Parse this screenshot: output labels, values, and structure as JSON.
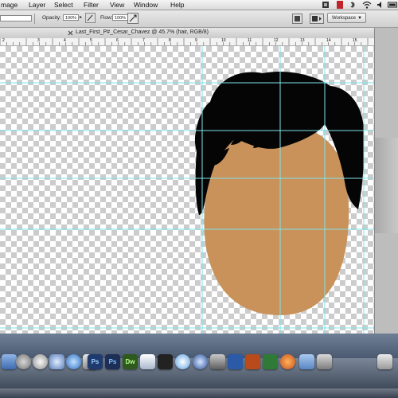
{
  "menubar": {
    "items": [
      "mage",
      "Layer",
      "Select",
      "Filter",
      "View",
      "Window",
      "Help"
    ]
  },
  "options_bar": {
    "opacity_label": "Opacity:",
    "opacity_value": "100%",
    "flow_label": "Flow:",
    "flow_value": "100%",
    "workspace_label": "Workspace"
  },
  "document": {
    "tab_title": "Last_First_P#_Cesar_Chavez @ 45.7% (hair, RGB/8)"
  },
  "ruler_marks": [
    "2",
    "3",
    "4",
    "5",
    "6",
    "7",
    "8",
    "9",
    "10",
    "11",
    "12",
    "13",
    "14",
    "15"
  ],
  "colors": {
    "skin": "#c9925a",
    "hair": "#050505",
    "guides": "#7fe3ea",
    "checker": "#cccccc"
  },
  "dock": {
    "apps": [
      {
        "label": "",
        "icon": "finder-icon"
      },
      {
        "label": "",
        "icon": "compass-icon"
      },
      {
        "label": "",
        "icon": "clock-icon"
      },
      {
        "label": "",
        "icon": "ichat-icon"
      },
      {
        "label": "",
        "icon": "safari-icon"
      },
      {
        "label": "",
        "icon": "mail-icon"
      },
      {
        "label": "Ps",
        "icon": "photoshop-icon"
      },
      {
        "label": "Ps",
        "icon": "photoshop-cs-icon"
      },
      {
        "label": "Dw",
        "icon": "dreamweaver-icon"
      },
      {
        "label": "",
        "icon": "preview-icon"
      },
      {
        "label": "",
        "icon": "terminal-icon"
      },
      {
        "label": "",
        "icon": "itunes-icon"
      },
      {
        "label": "",
        "icon": "quicktime-icon"
      },
      {
        "label": "",
        "icon": "chess-icon"
      },
      {
        "label": "",
        "icon": "word-icon"
      },
      {
        "label": "",
        "icon": "powerpoint-icon"
      },
      {
        "label": "",
        "icon": "excel-icon"
      },
      {
        "label": "",
        "icon": "firefox-icon"
      },
      {
        "label": "",
        "icon": "folder-icon"
      },
      {
        "label": "",
        "icon": "stacks-icon"
      },
      {
        "label": "",
        "icon": "trash-icon"
      }
    ]
  }
}
